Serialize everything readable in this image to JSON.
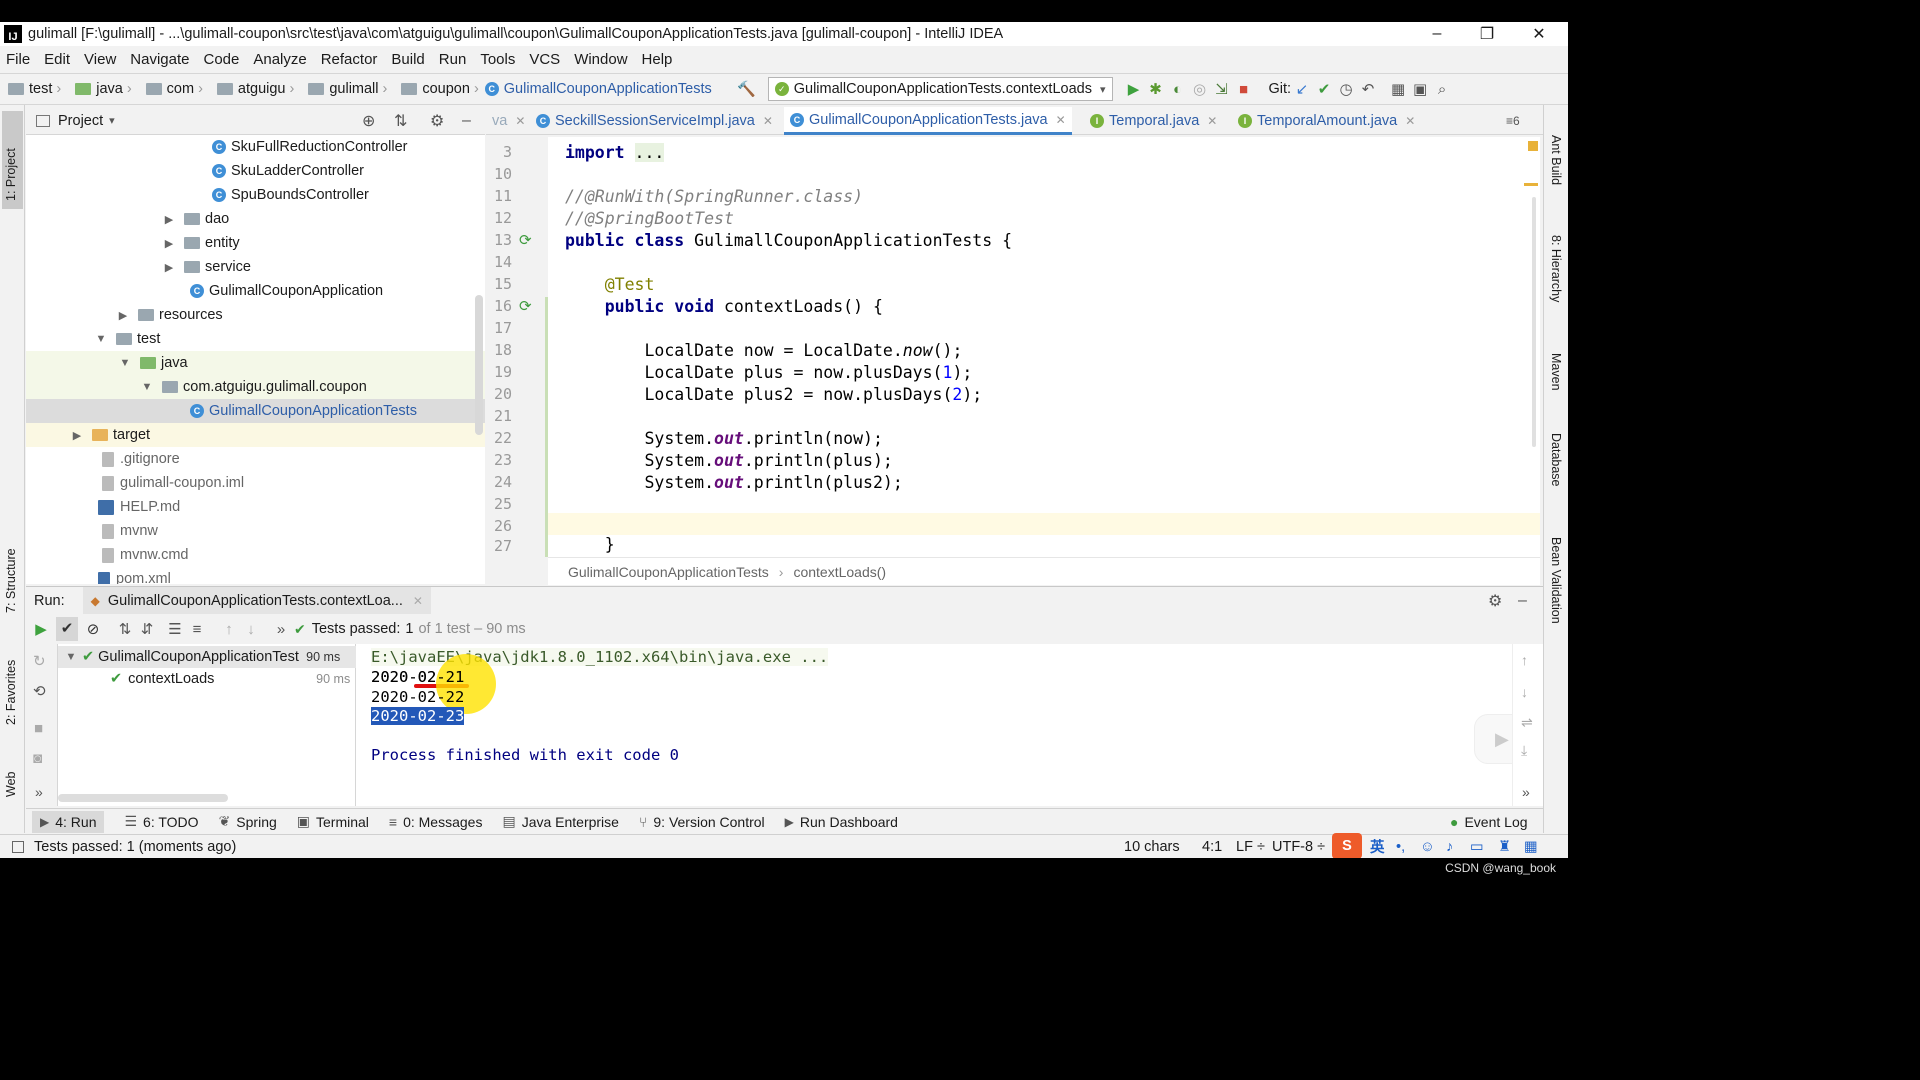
{
  "window": {
    "title": "gulimall [F:\\gulimall] - ...\\gulimall-coupon\\src\\test\\java\\com\\atguigu\\gulimall\\coupon\\GulimallCouponApplicationTests.java [gulimall-coupon] - IntelliJ IDEA",
    "logo": "IJ",
    "minimize": "–",
    "restore": "❐",
    "close": "✕"
  },
  "menu": [
    "File",
    "Edit",
    "View",
    "Navigate",
    "Code",
    "Analyze",
    "Refactor",
    "Build",
    "Run",
    "Tools",
    "VCS",
    "Window",
    "Help"
  ],
  "nav": {
    "crumbs": [
      "test",
      "java",
      "com",
      "atguigu",
      "gulimall",
      "coupon"
    ],
    "file": "GulimallCouponApplicationTests",
    "run_config": "GulimallCouponApplicationTests.contextLoads",
    "git_label": "Git:"
  },
  "project": {
    "title": "Project",
    "tree": [
      {
        "label": "SkuFullReductionController"
      },
      {
        "label": "SkuLadderController"
      },
      {
        "label": "SpuBoundsController"
      },
      {
        "label": "dao"
      },
      {
        "label": "entity"
      },
      {
        "label": "service"
      },
      {
        "label": "GulimallCouponApplication"
      },
      {
        "label": "resources"
      },
      {
        "label": "test"
      },
      {
        "label": "java"
      },
      {
        "label": "com.atguigu.gulimall.coupon"
      },
      {
        "label": "GulimallCouponApplicationTests"
      },
      {
        "label": "target"
      },
      {
        "label": ".gitignore"
      },
      {
        "label": "gulimall-coupon.iml"
      },
      {
        "label": "HELP.md"
      },
      {
        "label": "mvnw"
      },
      {
        "label": "mvnw.cmd"
      },
      {
        "label": "pom.xml"
      }
    ]
  },
  "editor": {
    "tabs": [
      {
        "label": "va"
      },
      {
        "label": "SeckillSessionServiceImpl.java"
      },
      {
        "label": "GulimallCouponApplicationTests.java"
      },
      {
        "label": "Temporal.java"
      },
      {
        "label": "TemporalAmount.java"
      }
    ],
    "tab_count": "≡6",
    "line_numbers": [
      "3",
      "10",
      "11",
      "12",
      "13",
      "14",
      "15",
      "16",
      "17",
      "18",
      "19",
      "20",
      "21",
      "22",
      "23",
      "24",
      "25",
      "26",
      "27"
    ],
    "breadcrumb": [
      "GulimallCouponApplicationTests",
      "contextLoads()"
    ]
  },
  "run": {
    "label": "Run:",
    "tab": "GulimallCouponApplicationTests.contextLoa...",
    "tests_passed": "Tests passed:",
    "passed_count": "1",
    "of_text": "of 1 test – 90 ms",
    "tree": [
      {
        "label": "GulimallCouponApplicationTest",
        "time": "90 ms"
      },
      {
        "label": "contextLoads",
        "time": "90 ms"
      }
    ],
    "console": [
      "E:\\javaEE\\java\\jdk1.8.0_1102.x64\\bin\\java.exe ...",
      "2020-02-21",
      "2020-02-22",
      "2020-02-23",
      "",
      "Process finished with exit code 0"
    ]
  },
  "bottom_tabs": [
    {
      "label": "4: Run"
    },
    {
      "label": "6: TODO"
    },
    {
      "label": "Spring"
    },
    {
      "label": "Terminal"
    },
    {
      "label": "0: Messages"
    },
    {
      "label": "Java Enterprise"
    },
    {
      "label": "9: Version Control"
    },
    {
      "label": "Run Dashboard"
    }
  ],
  "event_log": "Event Log",
  "status": {
    "message": "Tests passed: 1 (moments ago)",
    "chars": "10 chars",
    "position": "4:1",
    "line_sep": "LF ÷",
    "encoding": "UTF-8 ÷",
    "ime": "英"
  },
  "left_stripe": [
    "1: Project",
    "7: Structure",
    "2: Favorites",
    "Web"
  ],
  "right_stripe": [
    "Ant Build",
    "8: Hierarchy",
    "Maven",
    "Database",
    "Bean Validation"
  ],
  "watermark": "CSDN @wang_book",
  "colors": {
    "accent": "#4083c9",
    "pass": "#3e9b3e",
    "keyword": "#000080",
    "annotation": "#808000",
    "comment": "#808080"
  }
}
